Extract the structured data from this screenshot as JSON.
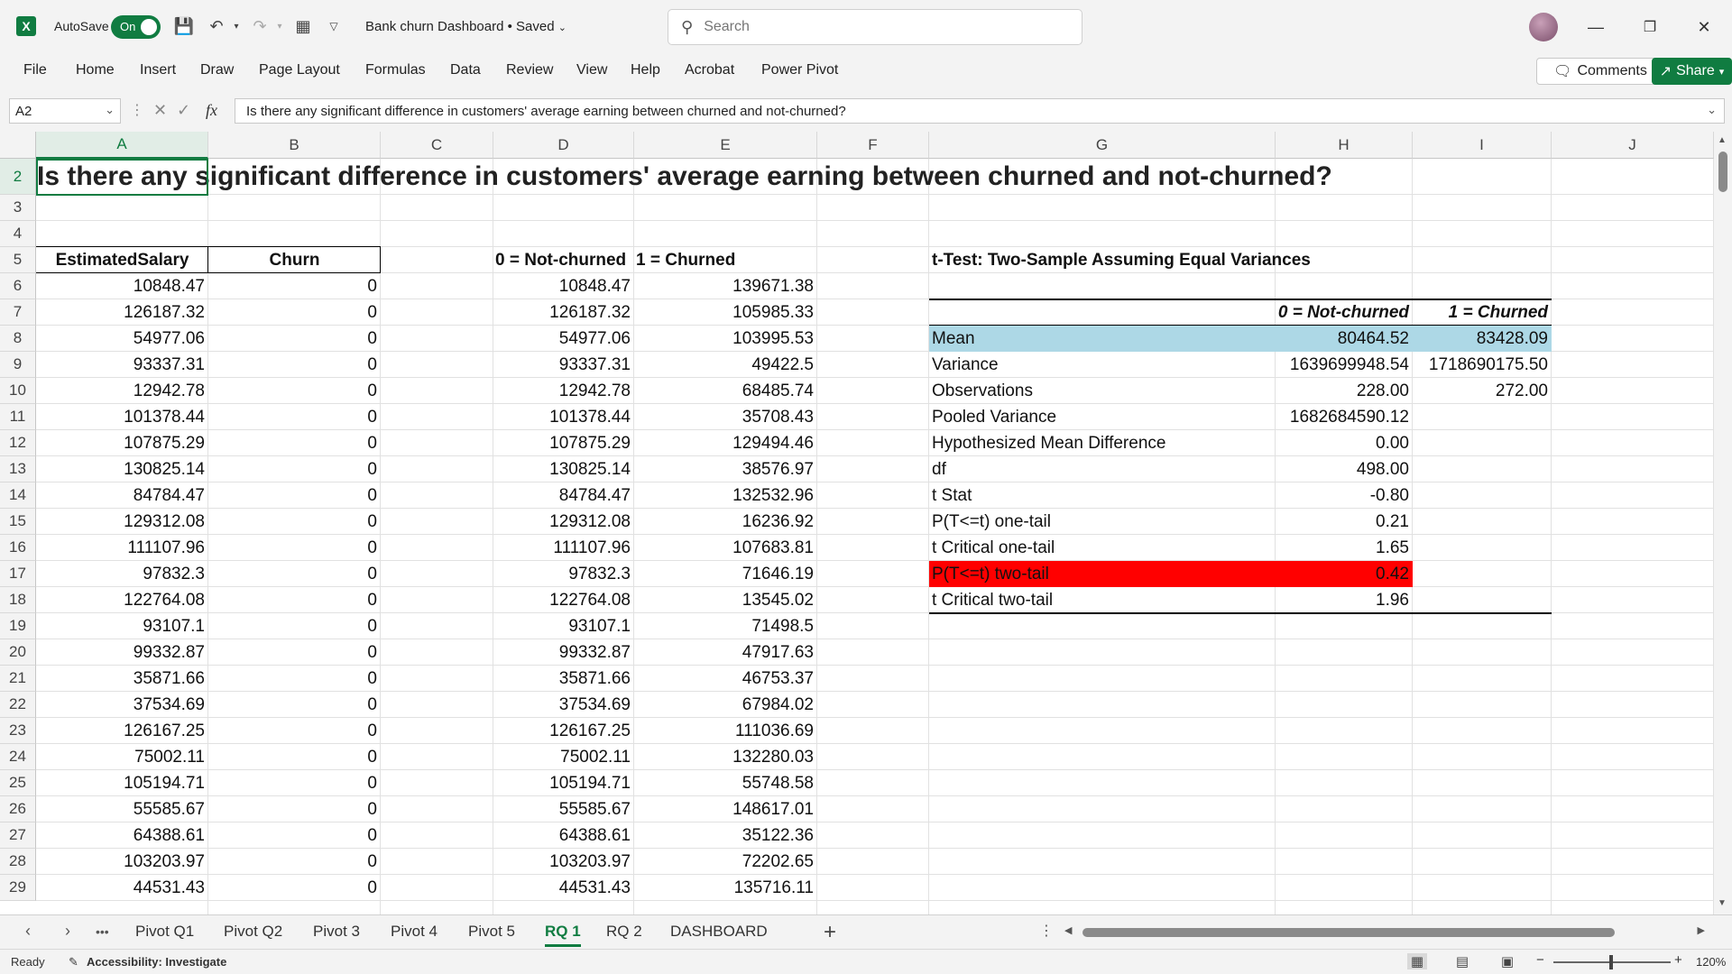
{
  "titlebar": {
    "autosave_label": "AutoSave",
    "autosave_state": "On",
    "doc_title": "Bank churn Dashboard • Saved ",
    "search_placeholder": "Search"
  },
  "menu": {
    "items": [
      "File",
      "Home",
      "Insert",
      "Draw",
      "Page Layout",
      "Formulas",
      "Data",
      "Review",
      "View",
      "Help",
      "Acrobat",
      "Power Pivot"
    ],
    "comments": "Comments",
    "share": "Share"
  },
  "formula_bar": {
    "name_box": "A2",
    "fx": "fx",
    "formula": "Is there any significant difference in customers' average earning between churned and not-churned?"
  },
  "grid": {
    "columns": [
      "A",
      "B",
      "C",
      "D",
      "E",
      "F",
      "G",
      "H",
      "I",
      "J"
    ],
    "rows": [
      "2",
      "3",
      "4",
      "5",
      "6",
      "7",
      "8",
      "9",
      "10",
      "11",
      "12",
      "13",
      "14",
      "15",
      "16",
      "17",
      "18",
      "19",
      "20",
      "21",
      "22",
      "23",
      "24",
      "25",
      "26",
      "27",
      "28",
      "29"
    ],
    "title": "Is there any significant difference in customers' average earning between churned and not-churned?",
    "headers": {
      "estimated_salary": "EstimatedSalary",
      "churn": "Churn",
      "not_churned": "0 = Not-churned",
      "churned": "1 = Churned"
    },
    "salary": [
      "10848.47",
      "126187.32",
      "54977.06",
      "93337.31",
      "12942.78",
      "101378.44",
      "107875.29",
      "130825.14",
      "84784.47",
      "129312.08",
      "111107.96",
      "97832.3",
      "122764.08",
      "93107.1",
      "99332.87",
      "35871.66",
      "37534.69",
      "126167.25",
      "75002.11",
      "105194.71",
      "55585.67",
      "64388.61",
      "103203.97",
      "44531.43"
    ],
    "churn": [
      "0",
      "0",
      "0",
      "0",
      "0",
      "0",
      "0",
      "0",
      "0",
      "0",
      "0",
      "0",
      "0",
      "0",
      "0",
      "0",
      "0",
      "0",
      "0",
      "0",
      "0",
      "0",
      "0",
      "0"
    ],
    "not_churned": [
      "10848.47",
      "126187.32",
      "54977.06",
      "93337.31",
      "12942.78",
      "101378.44",
      "107875.29",
      "130825.14",
      "84784.47",
      "129312.08",
      "111107.96",
      "97832.3",
      "122764.08",
      "93107.1",
      "99332.87",
      "35871.66",
      "37534.69",
      "126167.25",
      "75002.11",
      "105194.71",
      "55585.67",
      "64388.61",
      "103203.97",
      "44531.43"
    ],
    "churned": [
      "139671.38",
      "105985.33",
      "103995.53",
      "49422.5",
      "68485.74",
      "35708.43",
      "129494.46",
      "38576.97",
      "132532.96",
      "16236.92",
      "107683.81",
      "71646.19",
      "13545.02",
      "71498.5",
      "47917.63",
      "46753.37",
      "67984.02",
      "111036.69",
      "132280.03",
      "55748.58",
      "148617.01",
      "35122.36",
      "72202.65",
      "135716.11"
    ]
  },
  "ttest": {
    "title": "t-Test: Two-Sample Assuming Equal Variances",
    "col1": "0 = Not-churned",
    "col2": "1 = Churned",
    "rows": [
      {
        "label": "Mean",
        "v1": "80464.52",
        "v2": "83428.09"
      },
      {
        "label": "Variance",
        "v1": "1639699948.54",
        "v2": "1718690175.50"
      },
      {
        "label": "Observations",
        "v1": "228.00",
        "v2": "272.00"
      },
      {
        "label": "Pooled Variance",
        "v1": "1682684590.12",
        "v2": ""
      },
      {
        "label": "Hypothesized Mean Difference",
        "v1": "0.00",
        "v2": ""
      },
      {
        "label": "df",
        "v1": "498.00",
        "v2": ""
      },
      {
        "label": "t Stat",
        "v1": "-0.80",
        "v2": ""
      },
      {
        "label": "P(T<=t) one-tail",
        "v1": "0.21",
        "v2": ""
      },
      {
        "label": "t Critical one-tail",
        "v1": "1.65",
        "v2": ""
      },
      {
        "label": "P(T<=t) two-tail",
        "v1": "0.42",
        "v2": ""
      },
      {
        "label": "t Critical two-tail",
        "v1": "1.96",
        "v2": ""
      }
    ],
    "highlight_mean": "#add8e6",
    "highlight_p": "#ff0000"
  },
  "tabs": {
    "nav_more": "•••",
    "sheets": [
      "Pivot Q1",
      "Pivot Q2",
      "Pivot 3",
      "Pivot 4",
      "Pivot 5",
      "RQ 1",
      "RQ 2",
      "DASHBOARD"
    ],
    "active": "RQ 1"
  },
  "status": {
    "ready": "Ready",
    "accessibility": "Accessibility: Investigate",
    "zoom": "120%"
  },
  "colors": {
    "accent": "#107c41"
  }
}
